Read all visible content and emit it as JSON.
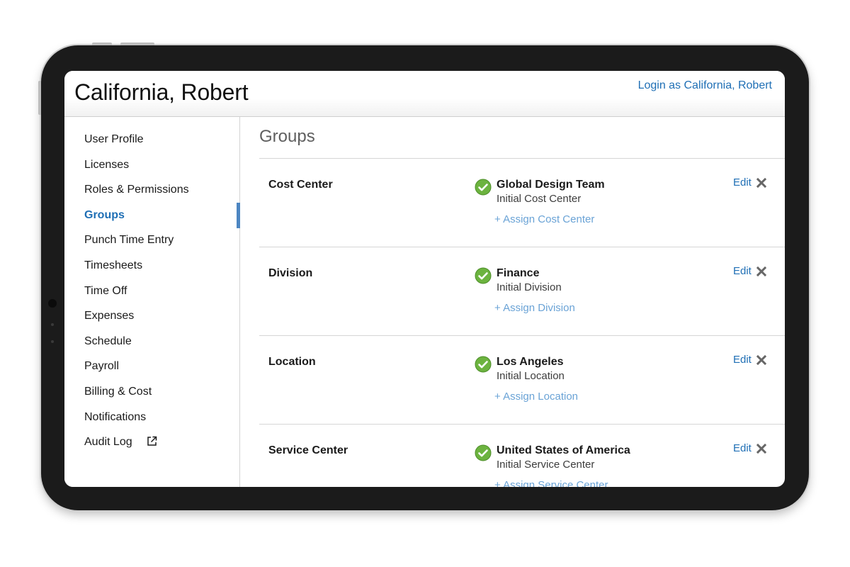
{
  "header": {
    "user_name": "California, Robert",
    "login_as_label": "Login as California, Robert"
  },
  "sidebar": {
    "active": "Groups",
    "items": [
      {
        "label": "User Profile"
      },
      {
        "label": "Licenses"
      },
      {
        "label": "Roles & Permissions"
      },
      {
        "label": "Groups"
      },
      {
        "label": "Punch Time Entry"
      },
      {
        "label": "Timesheets"
      },
      {
        "label": "Time Off"
      },
      {
        "label": "Expenses"
      },
      {
        "label": "Schedule"
      },
      {
        "label": "Payroll"
      },
      {
        "label": "Billing & Cost"
      },
      {
        "label": "Notifications"
      },
      {
        "label": "Audit Log",
        "icon": "external-link-icon"
      }
    ]
  },
  "main": {
    "title": "Groups",
    "edit_label": "Edit",
    "groups": [
      {
        "label": "Cost Center",
        "value": "Global Design Team",
        "sublabel": "Initial Cost Center",
        "assign_label": "+ Assign Cost Center"
      },
      {
        "label": "Division",
        "value": "Finance",
        "sublabel": "Initial Division",
        "assign_label": "+ Assign Division"
      },
      {
        "label": "Location",
        "value": "Los Angeles",
        "sublabel": "Initial Location",
        "assign_label": "+ Assign Location"
      },
      {
        "label": "Service Center",
        "value": "United States of America",
        "sublabel": "Initial Service Center",
        "assign_label": "+ Assign Service Center"
      }
    ]
  },
  "colors": {
    "accent": "#1f6fb5",
    "link_light": "#6aa3d6",
    "check_green": "#6cb33f"
  }
}
